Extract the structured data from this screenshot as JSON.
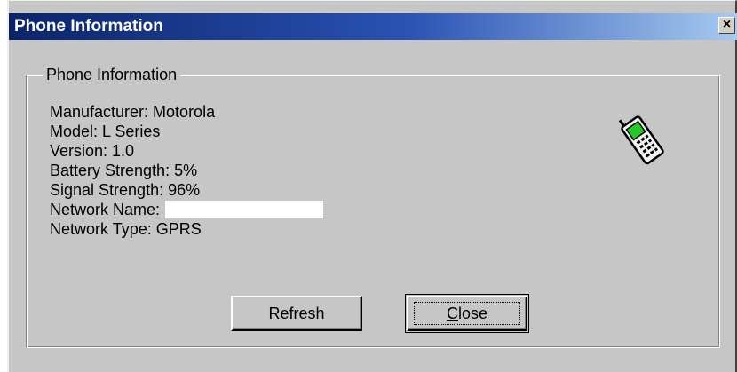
{
  "window": {
    "title": "Phone Information",
    "close_glyph": "×"
  },
  "group": {
    "label": "Phone Information"
  },
  "info": {
    "manufacturer": "Manufacturer: Motorola",
    "model": "Model: L Series",
    "version": "Version: 1.0",
    "battery": "Battery Strength: 5%",
    "signal": "Signal Strength: 96%",
    "network_name_label": "Network Name:",
    "network_name_value": "",
    "network_type": "Network Type: GPRS"
  },
  "icons": {
    "phone": "mobile-phone-icon"
  },
  "buttons": {
    "refresh": "Refresh",
    "close_mnemonic": "C",
    "close_rest": "lose"
  },
  "colors": {
    "title_start": "#0a246a",
    "title_end": "#a6caf0",
    "face": "#c6c6c6",
    "phone_screen": "#22cc22"
  }
}
